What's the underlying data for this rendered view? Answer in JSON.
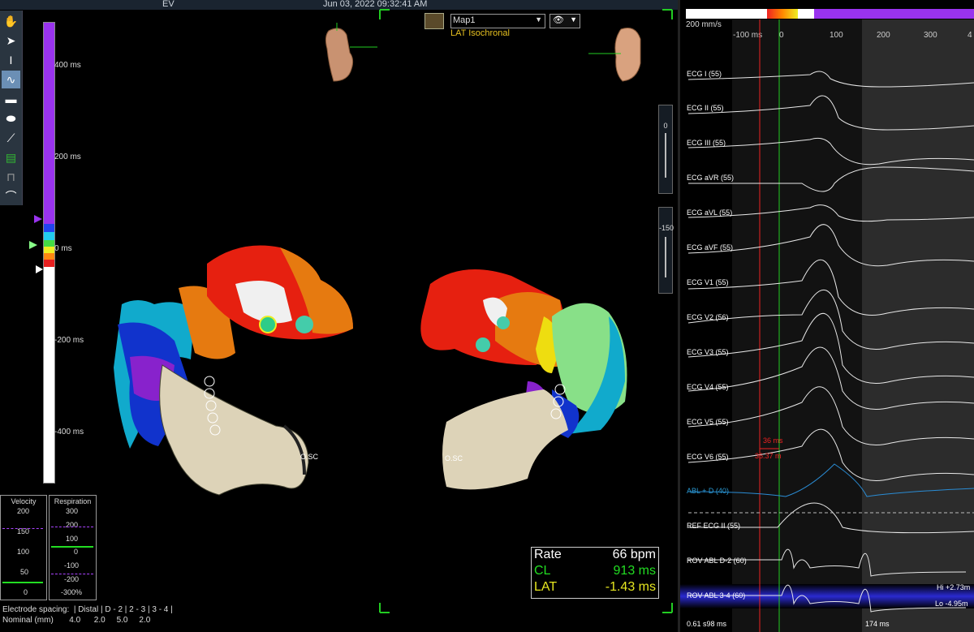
{
  "topbar": {
    "center_label": "EV",
    "datetime": "Jun 03, 2022 09:32:41 AM"
  },
  "tools": [
    "hand-icon",
    "pointer-icon",
    "text-cursor-icon",
    "curve-icon",
    "ruler-icon",
    "ellipse-icon",
    "eraser-icon",
    "layers-icon",
    "projection-icon",
    "catheter-icon"
  ],
  "scale": {
    "ticks": [
      "400 ms",
      "200 ms",
      "0 ms",
      "-200 ms",
      "-400 ms"
    ]
  },
  "map": {
    "selected": "Map1",
    "subtitle": "LAT Isochronal"
  },
  "labels": {
    "cs_left": "O.SC",
    "cs_right": "O.SC"
  },
  "slider1": {
    "value": "0"
  },
  "slider2": {
    "value": "-150"
  },
  "velocity": {
    "title": "Velocity",
    "ticks": [
      "200",
      "150",
      "100",
      "50",
      "0"
    ]
  },
  "respiration": {
    "title": "Respiration",
    "ticks": [
      "300",
      "200",
      "100",
      "0",
      "-100",
      "-200",
      "-300%"
    ]
  },
  "electrode": {
    "line1": "Electrode spacing:  | Distal | D - 2 | 2 - 3 | 3 - 4 |",
    "line2": "Nominal (mm)       4.0      2.0     5.0     2.0"
  },
  "rate": {
    "rate_label": "Rate",
    "rate_value": "66 bpm",
    "cl_label": "CL",
    "cl_value": "913 ms",
    "lat_label": "LAT",
    "lat_value": "-1.43 ms"
  },
  "egm": {
    "speed": "200 mm/s",
    "time_ticks": [
      "-100 ms",
      "0",
      "100",
      "200",
      "300",
      "4"
    ],
    "channels": [
      "ECG I (55)",
      "ECG II (55)",
      "ECG III (55)",
      "ECG aVR (55)",
      "ECG aVL (55)",
      "ECG aVF (55)",
      "ECG V1 (55)",
      "ECG V2 (56)",
      "ECG V3 (55)",
      "ECG V4 (55)",
      "ECG V5 (55)",
      "ECG V6 (55)",
      "ABL + D (40)",
      "REF ECG II (55)",
      "ROV ABL  D-2 (60)",
      "ROV ABL  3-4 (60)"
    ],
    "measure_top": "36 ms",
    "measure_bot": "36.37 m",
    "hi": "Hi +2.73m",
    "lo": "Lo -4.95m",
    "bottom_left": "0.61 s98 ms",
    "bottom_mid": "174 ms"
  },
  "colors": {
    "purple": "#9933ee",
    "red": "#e62020",
    "green_text": "#22dd22",
    "yellow_text": "#e6e620"
  }
}
